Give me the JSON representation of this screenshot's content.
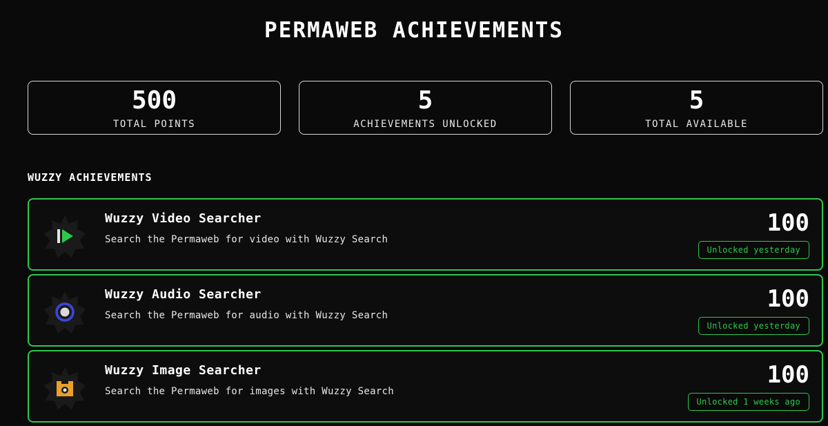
{
  "page": {
    "title": "PERMAWEB ACHIEVEMENTS"
  },
  "stats": [
    {
      "value": "500",
      "label": "TOTAL POINTS"
    },
    {
      "value": "5",
      "label": "ACHIEVEMENTS UNLOCKED"
    },
    {
      "value": "5",
      "label": "TOTAL AVAILABLE"
    }
  ],
  "section": {
    "title": "WUZZY ACHIEVEMENTS"
  },
  "achievements": [
    {
      "icon": "video-play-icon",
      "name": "Wuzzy Video Searcher",
      "description": "Search the Permaweb for video with Wuzzy Search",
      "points": "100",
      "status": "Unlocked yesterday"
    },
    {
      "icon": "audio-record-icon",
      "name": "Wuzzy Audio Searcher",
      "description": "Search the Permaweb for audio with Wuzzy Search",
      "points": "100",
      "status": "Unlocked yesterday"
    },
    {
      "icon": "image-camera-icon",
      "name": "Wuzzy Image Searcher",
      "description": "Search the Permaweb for images with Wuzzy Search",
      "points": "100",
      "status": "Unlocked 1 weeks ago"
    }
  ],
  "colors": {
    "accent": "#2ec94a",
    "background": "#0a0a0a",
    "audio_ring": "#3b47e0",
    "image_icon": "#e8a02a"
  }
}
